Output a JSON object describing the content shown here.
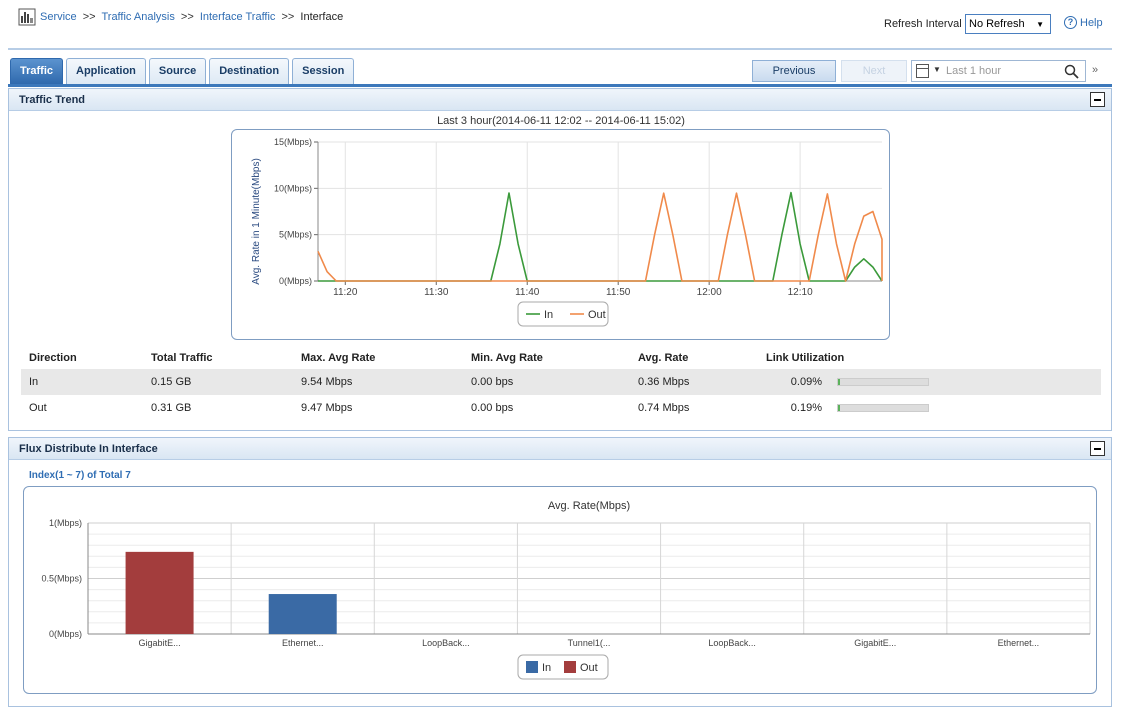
{
  "breadcrumb": {
    "items": [
      "Service",
      "Traffic Analysis",
      "Interface Traffic"
    ],
    "separator": ">>",
    "current": "Interface"
  },
  "header": {
    "refresh_label": "Refresh Interval",
    "refresh_value": "No Refresh",
    "help_label": "Help"
  },
  "tabs": [
    {
      "label": "Traffic",
      "active": true
    },
    {
      "label": "Application",
      "active": false
    },
    {
      "label": "Source",
      "active": false
    },
    {
      "label": "Destination",
      "active": false
    },
    {
      "label": "Session",
      "active": false
    }
  ],
  "toolbar": {
    "previous_label": "Previous",
    "next_label": "Next",
    "time_range": "Last 1 hour",
    "expand_glyph": "»"
  },
  "traffic_trend": {
    "title": "Traffic Trend",
    "range_label": "Last 3 hour(2014-06-11 12:02 -- 2014-06-11 15:02)"
  },
  "stats": {
    "headers": [
      "Direction",
      "Total Traffic",
      "Max. Avg Rate",
      "Min. Avg Rate",
      "Avg. Rate",
      "Link Utilization"
    ],
    "rows": [
      {
        "direction": "In",
        "total": "0.15 GB",
        "max": "9.54 Mbps",
        "min": "0.00 bps",
        "avg": "0.36 Mbps",
        "util": "0.09%",
        "util_value": 0.0009
      },
      {
        "direction": "Out",
        "total": "0.31 GB",
        "max": "9.47 Mbps",
        "min": "0.00 bps",
        "avg": "0.74 Mbps",
        "util": "0.19%",
        "util_value": 0.0019
      }
    ]
  },
  "flux": {
    "title": "Flux Distribute In Interface",
    "index_label": "Index(1 ~ 7) of Total 7"
  },
  "colors": {
    "in_line": "#3b9a3b",
    "out_line": "#f08a4b",
    "in_bar": "#3a6aa5",
    "out_bar": "#a33d3d"
  },
  "chart_data": [
    {
      "type": "line",
      "title": "",
      "ylabel": "Avg. Rate in 1 Minute(Mbps)",
      "ylim": [
        0,
        15
      ],
      "yticks": [
        {
          "v": 0,
          "label": "0(Mbps)"
        },
        {
          "v": 5,
          "label": "5(Mbps)"
        },
        {
          "v": 10,
          "label": "10(Mbps)"
        },
        {
          "v": 15,
          "label": "15(Mbps)"
        }
      ],
      "xlim": [
        "11:17",
        "11:19"
      ],
      "xticks": [
        "11:20",
        "11:30",
        "11:40",
        "11:50",
        "12:00",
        "12:10"
      ],
      "grid": true,
      "legend_position": "bottom",
      "series": [
        {
          "name": "In",
          "points": [
            [
              "11:17",
              0
            ],
            [
              "11:36",
              0
            ],
            [
              "11:37",
              4
            ],
            [
              "11:38",
              9.5
            ],
            [
              "11:39",
              4
            ],
            [
              "11:40",
              0
            ],
            [
              "12:07",
              0
            ],
            [
              "12:08",
              5
            ],
            [
              "12:09",
              9.54
            ],
            [
              "12:10",
              4
            ],
            [
              "12:11",
              0
            ],
            [
              "12:15",
              0
            ],
            [
              "12:16",
              1.5
            ],
            [
              "12:17",
              2.4
            ],
            [
              "12:18",
              1.5
            ],
            [
              "12:19",
              0
            ]
          ]
        },
        {
          "name": "Out",
          "points": [
            [
              "11:17",
              3.2
            ],
            [
              "11:18",
              1
            ],
            [
              "11:19",
              0
            ],
            [
              "11:53",
              0
            ],
            [
              "11:54",
              5
            ],
            [
              "11:55",
              9.47
            ],
            [
              "11:56",
              5
            ],
            [
              "11:57",
              0
            ],
            [
              "12:01",
              0
            ],
            [
              "12:02",
              5
            ],
            [
              "12:03",
              9.47
            ],
            [
              "12:04",
              5
            ],
            [
              "12:05",
              0
            ],
            [
              "12:11",
              0
            ],
            [
              "12:12",
              5
            ],
            [
              "12:13",
              9.4
            ],
            [
              "12:14",
              4
            ],
            [
              "12:15",
              0
            ],
            [
              "12:16",
              4
            ],
            [
              "12:17",
              7
            ],
            [
              "12:18",
              7.5
            ],
            [
              "12:19",
              4.5
            ],
            [
              "12:19",
              0
            ]
          ]
        }
      ]
    },
    {
      "type": "bar",
      "title": "Avg. Rate(Mbps)",
      "ylim": [
        0,
        1
      ],
      "yticks": [
        {
          "v": 0,
          "label": "0(Mbps)"
        },
        {
          "v": 0.5,
          "label": "0.5(Mbps)"
        },
        {
          "v": 1,
          "label": "1(Mbps)"
        }
      ],
      "categories": [
        "GigabitE...",
        "Ethernet...",
        "LoopBack...",
        "Tunnel1(...",
        "LoopBack...",
        "GigabitE...",
        "Ethernet..."
      ],
      "legend_position": "bottom",
      "series": [
        {
          "name": "In",
          "values": [
            0,
            0.36,
            0,
            0,
            0,
            0,
            0
          ]
        },
        {
          "name": "Out",
          "values": [
            0.74,
            0,
            0,
            0,
            0,
            0,
            0
          ]
        }
      ]
    }
  ]
}
